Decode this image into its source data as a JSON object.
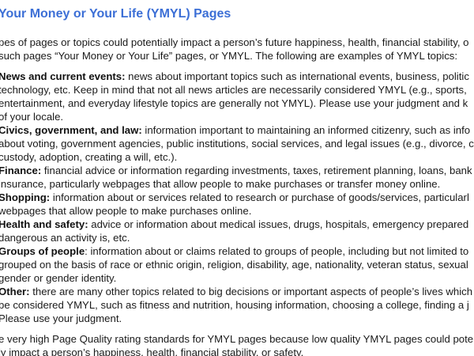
{
  "heading": "Your Money or Your Life (YMYL) Pages",
  "intro": [
    "pes of pages or topics could potentially impact a person’s future happiness, health, financial stability, o",
    "such pages “Your Money or Your Life” pages, or YMYL.  The following are examples of YMYL topics:"
  ],
  "topics": [
    {
      "term": "News and current events:",
      "lines": [
        " news about important topics such as international events, business, politic",
        "technology, etc.  Keep in mind that not all news articles are necessarily considered YMYL (e.g., sports,",
        "entertainment, and everyday lifestyle topics are generally not YMYL).  Please use your judgment and k",
        "of your locale."
      ]
    },
    {
      "term": "Civics, government, and law:",
      "lines": [
        " information important to maintaining an informed citizenry, such as info",
        "about voting, government agencies, public institutions, social services, and legal issues (e.g., divorce, c",
        "custody, adoption, creating a will, etc.)."
      ]
    },
    {
      "term": "Finance:",
      "lines": [
        " financial advice or information regarding investments, taxes, retirement planning, loans, bank",
        "insurance, particularly webpages that allow people to make purchases or transfer money online."
      ]
    },
    {
      "term": "Shopping:",
      "lines": [
        " information about or services related to research or purchase of goods/services, particularl",
        "webpages that allow people to make purchases online."
      ]
    },
    {
      "term": "Health and safety:",
      "lines": [
        " advice or information about medical issues, drugs, hospitals, emergency prepared",
        "dangerous an activity is, etc."
      ]
    },
    {
      "term": "Groups of people",
      "lines": [
        ": information about or claims related to groups of people, including but not limited to",
        "grouped on the basis of race or ethnic origin, religion, disability, age, nationality, veteran status, sexual",
        "gender or gender identity."
      ]
    },
    {
      "term": "Other:",
      "lines": [
        " there are many other topics related to big decisions or important aspects of people’s lives which",
        "be considered YMYL, such as fitness and nutrition, housing information, choosing a college, finding a j",
        "Please use your judgment."
      ]
    }
  ],
  "closing": [
    "e very high Page Quality rating standards for YMYL pages because low quality YMYL pages could pote",
    "ly impact a person’s happiness, health, financial stability, or safety."
  ]
}
